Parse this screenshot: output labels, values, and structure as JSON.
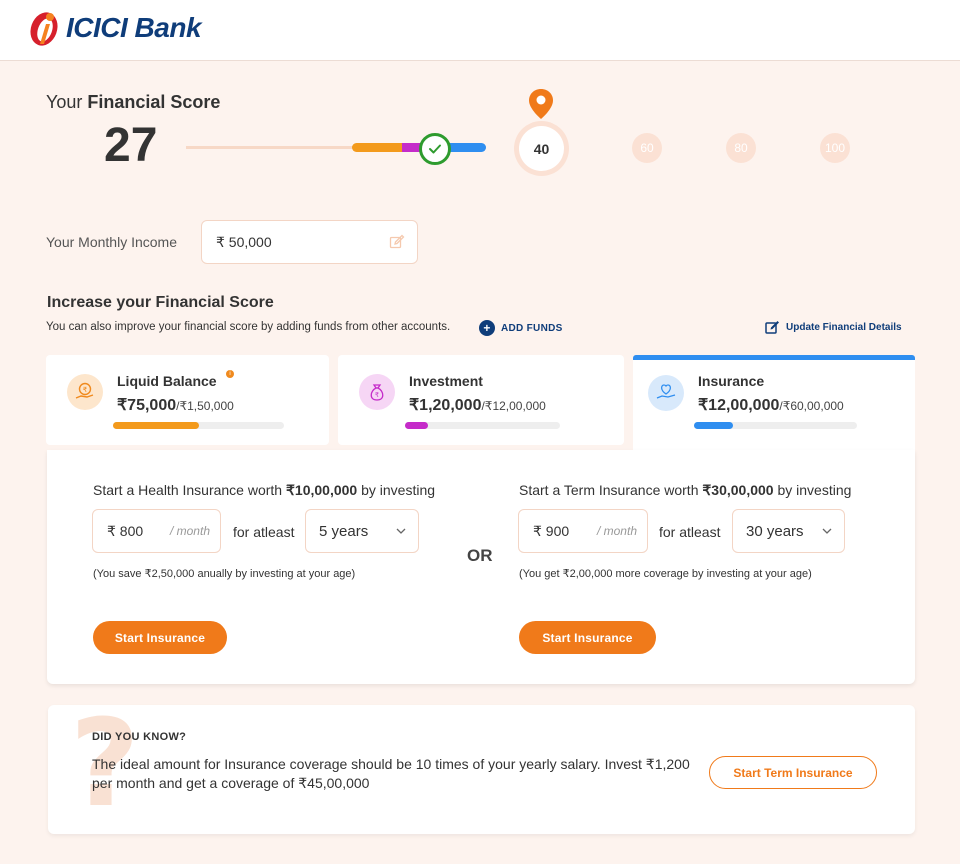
{
  "header": {
    "brand_name": "ICICI Bank"
  },
  "score": {
    "label_prefix": "Your ",
    "label_bold": "Financial Score",
    "value": "27",
    "current_milestone": "40",
    "milestones": [
      "60",
      "80",
      "100"
    ],
    "progress_segments": [
      {
        "name": "liquid",
        "color": "#f39a1c"
      },
      {
        "name": "investment",
        "color": "#c52bc9"
      },
      {
        "name": "insurance",
        "color": "#2f8ef0"
      }
    ]
  },
  "income": {
    "label": "Your Monthly Income",
    "value": "₹ 50,000"
  },
  "increase": {
    "title": "Increase your Financial Score",
    "subtitle": "You can also improve your financial score by adding funds from other accounts.",
    "add_funds": "ADD FUNDS",
    "update_details": "Update Financial Details"
  },
  "tabs": [
    {
      "title": "Liquid Balance",
      "value": "₹75,000",
      "total": "/₹1,50,000",
      "progress": 0.5,
      "color": "#f39a1c",
      "icon": "hand-rupee-icon"
    },
    {
      "title": "Investment",
      "value": "₹1,20,000",
      "total": "/₹12,00,000",
      "progress": 0.15,
      "color": "#c52bc9",
      "icon": "money-bag-icon"
    },
    {
      "title": "Insurance",
      "value": "₹12,00,000",
      "total": "/₹60,00,000",
      "progress": 0.24,
      "color": "#2f8ef0",
      "icon": "heart-hand-icon"
    }
  ],
  "health": {
    "text_prefix": "Start a Health Insurance worth ",
    "text_amount": "₹10,00,000",
    "text_suffix": " by investing",
    "amount": "₹ 800",
    "per": "/ month",
    "for_atleast": "for atleast",
    "duration": "5 years",
    "note": "(You save ₹2,50,000 anually by investing at your age)",
    "button": "Start Insurance"
  },
  "or_label": "OR",
  "term": {
    "text_prefix": "Start a Term Insurance worth ",
    "text_amount": "₹30,00,000",
    "text_suffix": " by investing",
    "amount": "₹ 900",
    "per": "/ month",
    "for_atleast": "for atleast",
    "duration": "30 years",
    "note": "(You get ₹2,00,000 more coverage by investing at your age)",
    "button": "Start Insurance"
  },
  "did_you_know": {
    "title": "DID YOU KNOW?",
    "body": "The ideal amount for Insurance coverage should be 10 times of your yearly salary. Invest ₹1,200 per month and get a coverage of ₹45,00,000",
    "button": "Start Term Insurance"
  }
}
